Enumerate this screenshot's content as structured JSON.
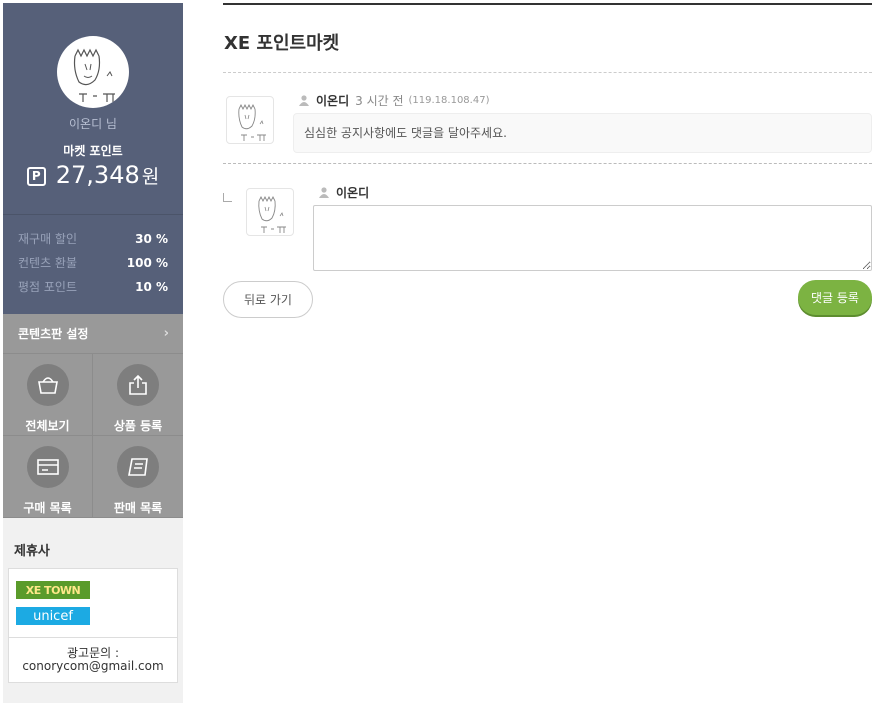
{
  "sidebar": {
    "nickname": "이온디 님",
    "point_title": "마켓 포인트",
    "point_badge": "P",
    "point_value": "27,348",
    "point_unit": "원",
    "stats": [
      {
        "label": "재구매 할인",
        "value": "30 %"
      },
      {
        "label": "컨텐츠 환불",
        "value": "100 %"
      },
      {
        "label": "평점 포인트",
        "value": "10 %"
      }
    ],
    "settings_label": "콘텐츠판 설정",
    "menu": [
      {
        "label": "전체보기",
        "icon": "basket-icon"
      },
      {
        "label": "상품 등록",
        "icon": "upload-icon"
      },
      {
        "label": "구매 목록",
        "icon": "card-icon"
      },
      {
        "label": "판매 목록",
        "icon": "document-icon"
      }
    ],
    "partners_title": "제휴사",
    "partners": [
      {
        "name": "XE TOWN"
      },
      {
        "name": "unicef"
      }
    ],
    "contact_label": "광고문의 :",
    "contact_email": "conorycom@gmail.com"
  },
  "main": {
    "title": "XE 포인트마켓",
    "comment": {
      "author": "이온디",
      "time": "3 시간 전",
      "ip": "(119.18.108.47)",
      "text": "심심한 공지사항에도 댓글을 달아주세요."
    },
    "reply": {
      "author": "이온디",
      "value": ""
    },
    "back_label": "뒤로 가기",
    "submit_label": "댓글 등록"
  },
  "colors": {
    "sidebar_profile_bg": "#566079",
    "sidebar_menu_bg": "#999999",
    "submit_green": "#7cb342"
  }
}
